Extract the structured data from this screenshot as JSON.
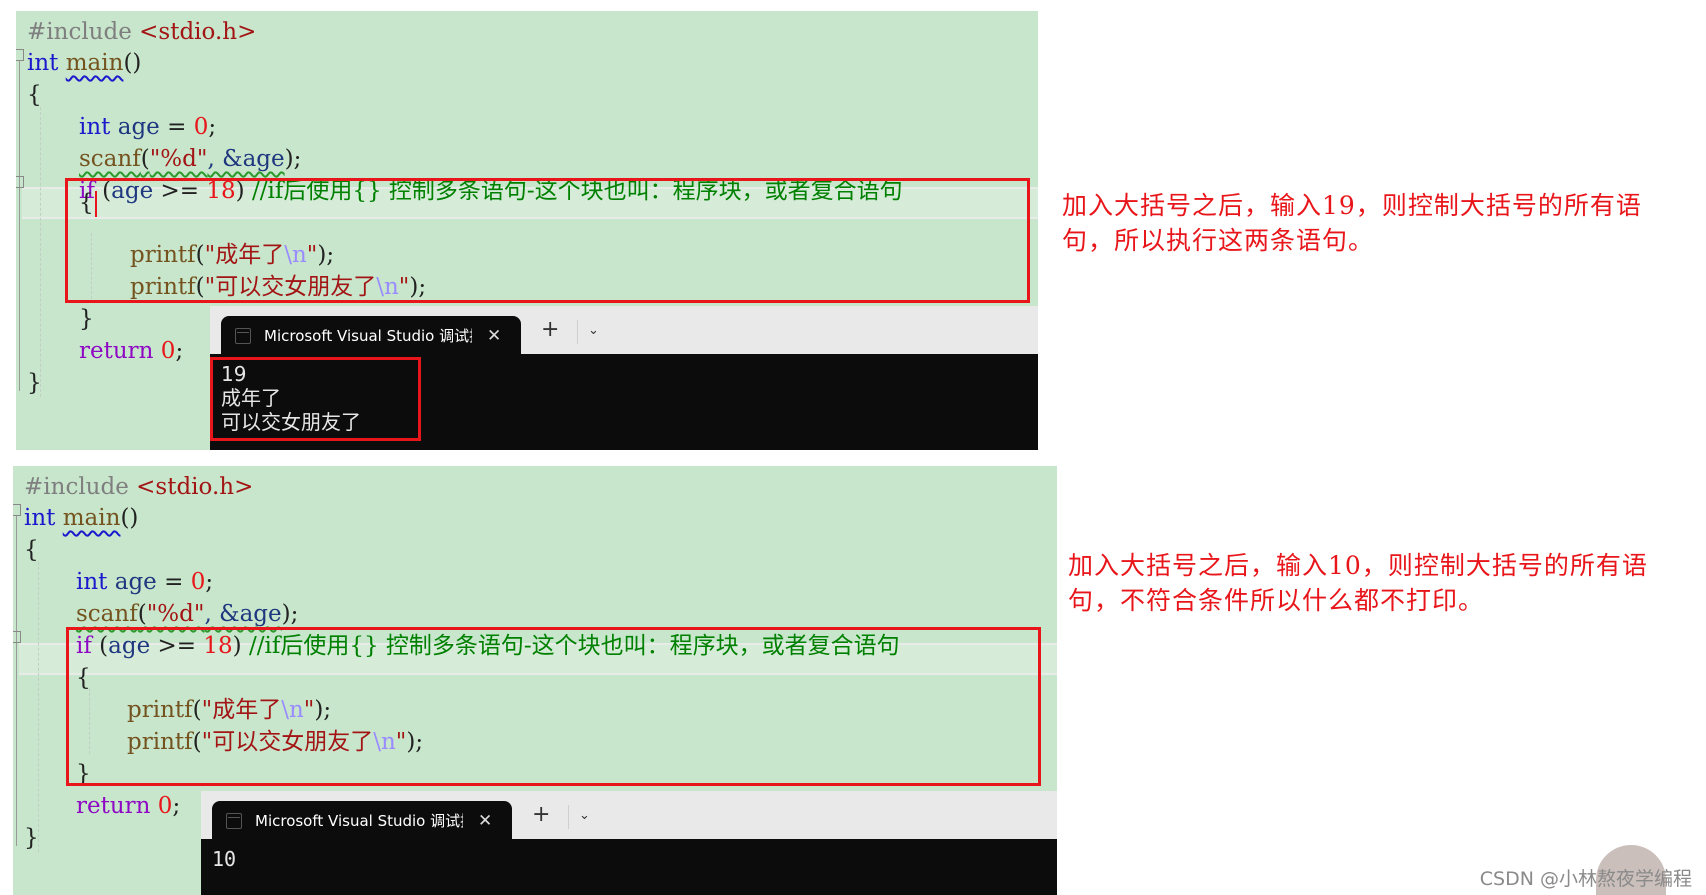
{
  "code": {
    "include_directive": "#include",
    "include_header": "<stdio.h>",
    "kw_int": "int",
    "fn_main": "main",
    "parens": "()",
    "open_brace": "{",
    "close_brace": "}",
    "var_age": "age",
    "assign": " = ",
    "zero": "0",
    "semi": ";",
    "fn_scanf": "scanf",
    "scanf_open": "(",
    "fmt_d": "\"%d\"",
    "scanf_args": ", &age",
    "close_paren_semi": ");",
    "kw_if": "if",
    "if_cond_open": " (",
    "ge_op": " >= ",
    "num_18": "18",
    "if_cond_close": ") ",
    "comment": "//if后使用{} 控制多条语句-这个块也叫：程序块，或者复合语句",
    "fn_printf": "printf",
    "paren_open": "(",
    "str1": "\"成年了",
    "str2": "\"可以交女朋友了",
    "esc_n": "\\n",
    "quote": "\"",
    "kw_return": "return",
    "space": " "
  },
  "consoles": {
    "top": {
      "tab_title": "Microsoft Visual Studio 调试控制台",
      "close": "✕",
      "new_tab": "+",
      "dropdown": "⌄",
      "output": [
        "19",
        "成年了",
        "可以交女朋友了"
      ]
    },
    "bottom": {
      "tab_title": "Microsoft Visual Studio 调试控制台",
      "close": "✕",
      "new_tab": "+",
      "dropdown": "⌄",
      "output": [
        "10"
      ]
    }
  },
  "annotations": {
    "top": "加入大括号之后，输入19，则控制大括号的所有语句，所以执行这两条语句。",
    "bottom": "加入大括号之后，输入10，则控制大括号的所有语句，不符合条件所以什么都不打印。"
  },
  "colors": {
    "editor_bg": "#c7e6cc",
    "highlight_red": "#e8161a",
    "console_bg": "#0c0c0c"
  },
  "watermark": "CSDN @小林熬夜学编程"
}
